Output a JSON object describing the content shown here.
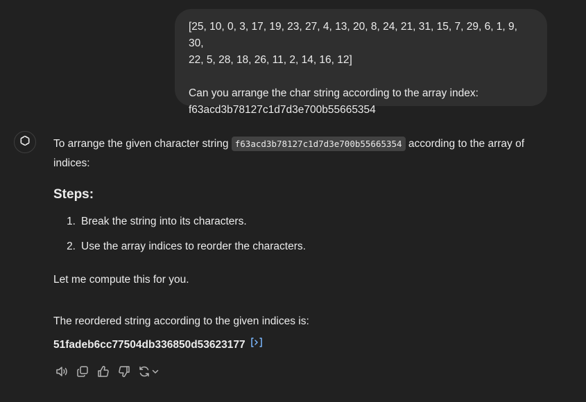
{
  "user_message": {
    "array_line_1": "[25, 10, 0, 3, 17, 19, 23, 27, 4, 13, 20, 8, 24, 21, 31, 15, 7, 29, 6, 1, 9, 30,",
    "array_line_2": "22, 5, 28, 18, 26, 11, 2, 14, 16, 12]",
    "question": "Can you arrange the char string according to the array index:",
    "string": "f63acd3b78127c1d7d3e700b55665354"
  },
  "assistant_message": {
    "intro_before": "To arrange the given character string ",
    "intro_code": "f63acd3b78127c1d7d3e700b55665354",
    "intro_after": " according to the array of indices:",
    "steps_heading": "Steps:",
    "steps": [
      {
        "number": "1.",
        "text": "Break the string into its characters."
      },
      {
        "number": "2.",
        "text": "Use the array indices to reorder the characters."
      }
    ],
    "compute_text": "Let me compute this for you.",
    "result_intro": "The reordered string according to the given indices is:",
    "result_value": "51fadeb6cc77504db336850d53623177"
  },
  "action_icons": [
    "read-aloud-icon",
    "copy-icon",
    "thumbs-up-icon",
    "thumbs-down-icon",
    "regenerate-icon"
  ],
  "colors": {
    "background": "#212121",
    "user_bubble": "#2f2f2f",
    "text": "#ececec",
    "icon": "#b4b4b4",
    "code_link": "#7ab7ff"
  }
}
